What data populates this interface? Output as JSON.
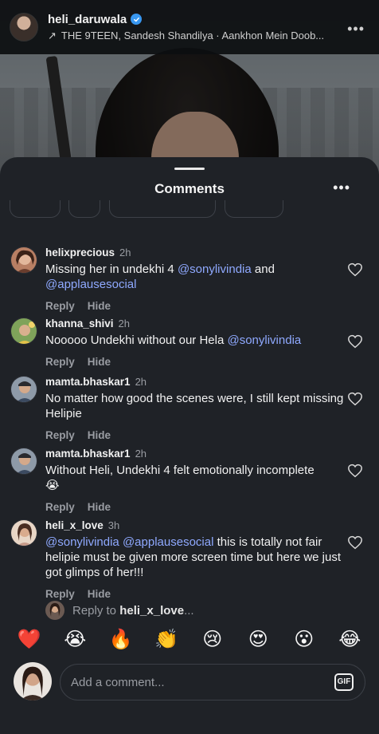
{
  "header": {
    "username": "heli_daruwala",
    "audio": "THE 9TEEN, Sandesh Shandilya · Aankhon Mein Doob...",
    "more_label": "•••"
  },
  "sheet": {
    "title": "Comments",
    "more_label": "•••"
  },
  "comments": [
    {
      "user": "helixprecious",
      "time": "2h",
      "text_before": "Missing her in undekhi 4 ",
      "mention1": "@sonylivindia",
      "text_mid": " and",
      "mention2": "@applausesocial",
      "text_after": "",
      "reply_label": "Reply",
      "hide_label": "Hide"
    },
    {
      "user": "khanna_shivi",
      "time": "2h",
      "text_before": "Nooooo Undekhi without our Hela ",
      "mention1": "@sonylivindia",
      "reply_label": "Reply",
      "hide_label": "Hide"
    },
    {
      "user": "mamta.bhaskar1",
      "time": "2h",
      "text_before": "No matter how good the scenes were, I still kept missing Helipie",
      "reply_label": "Reply",
      "hide_label": "Hide"
    },
    {
      "user": "mamta.bhaskar1",
      "time": "2h",
      "text_before": "Without Heli, Undekhi 4 felt emotionally incomplete",
      "emoji": "😭",
      "reply_label": "Reply",
      "hide_label": "Hide"
    },
    {
      "user": "heli_x_love",
      "time": "3h",
      "mention1": "@sonylivindia",
      "mention2": "@applausesocial",
      "text_after": " this is totally not fair helipie must be given more screen time but here we just got glimps of her!!!",
      "reply_label": "Reply",
      "hide_label": "Hide"
    }
  ],
  "reply_to": {
    "prefix": "Reply to ",
    "user": "heli_x_love",
    "suffix": "..."
  },
  "emoji_bar": [
    "❤️",
    "😭",
    "🔥",
    "👏",
    "😢",
    "😍",
    "😮",
    "😂"
  ],
  "composer": {
    "placeholder": "Add a comment...",
    "gif_label": "GIF"
  },
  "colors": {
    "sheet_bg": "#1f2227",
    "mention": "#8fa9ff",
    "verified": "#3897f0"
  }
}
